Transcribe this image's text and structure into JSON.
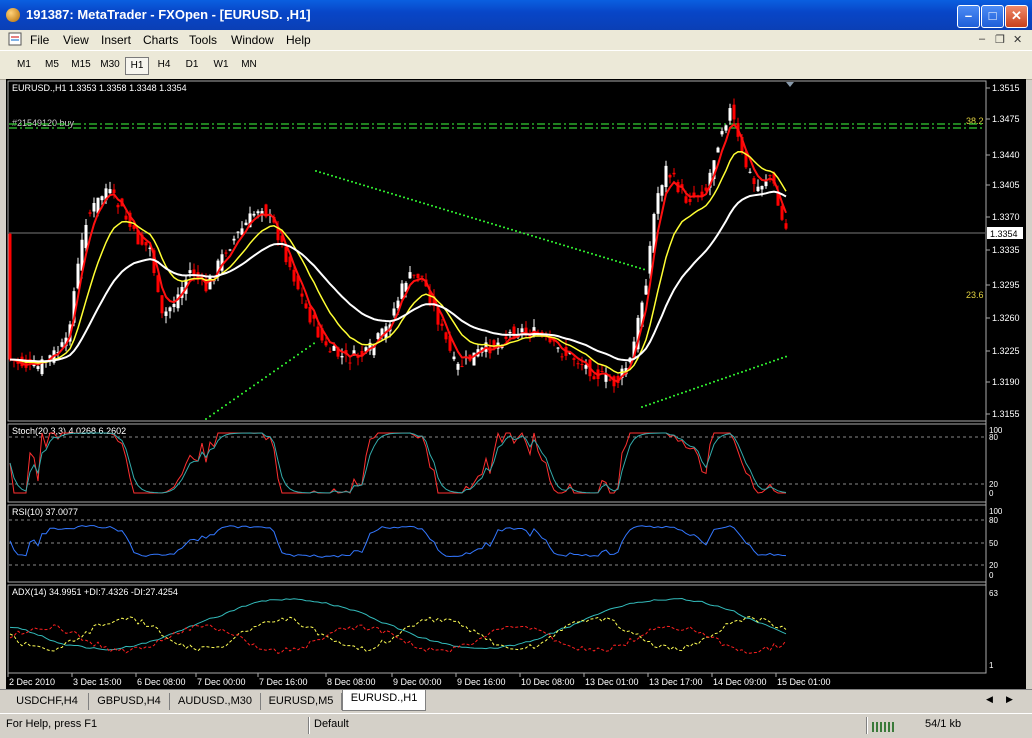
{
  "window": {
    "title": "191387: MetaTrader - FXOpen - [EURUSD. ,H1]"
  },
  "menu": [
    "File",
    "View",
    "Insert",
    "Charts",
    "Tools",
    "Window",
    "Help"
  ],
  "timeframes": [
    "M1",
    "M5",
    "M15",
    "M30",
    "H1",
    "H4",
    "D1",
    "W1",
    "MN"
  ],
  "active_timeframe": "H1",
  "chart": {
    "header": "EURUSD.,H1  1.3353 1.3358 1.3348 1.3354",
    "order_label": "#21549120 buy",
    "fib_top": "38.2",
    "fib_bottom": "23.6",
    "current_price": "1.3354",
    "price_ticks": [
      "1.3515",
      "1.3475",
      "1.3440",
      "1.3405",
      "1.3370",
      "1.3335",
      "1.3295",
      "1.3260",
      "1.3225",
      "1.3190",
      "1.3155"
    ],
    "time_ticks": [
      "2 Dec 2010",
      "3 Dec 15:00",
      "6 Dec 08:00",
      "7 Dec 00:00",
      "7 Dec 16:00",
      "8 Dec 08:00",
      "9 Dec 00:00",
      "9 Dec 16:00",
      "10 Dec 08:00",
      "13 Dec 01:00",
      "13 Dec 17:00",
      "14 Dec 09:00",
      "15 Dec 01:00"
    ],
    "stoch": {
      "label": "Stoch(20,3,3) 4.0268 6.2602",
      "levels": [
        "100",
        "80",
        "20",
        "0"
      ]
    },
    "rsi": {
      "label": "RSI(10) 37.0077",
      "levels": [
        "100",
        "80",
        "50",
        "20",
        "0"
      ]
    },
    "adx": {
      "label": "ADX(14) 34.9951 +DI:7.4326 -DI:27.4254",
      "levels": [
        "63",
        "1"
      ]
    },
    "colors": {
      "up": "#ffffff",
      "down": "#ff0000",
      "ma_fast": "#ff1010",
      "ma_mid": "#ffff33",
      "ma_slow": "#ffffff",
      "psar": "#33ff33",
      "fib": "#33cc33",
      "stoch_main": "#ff3030",
      "stoch_signal": "#33aaaa",
      "rsi": "#3377ff",
      "adx": "#33bbbb",
      "plus_di": "#ffff55",
      "minus_di": "#ff2020"
    }
  },
  "tabs": [
    "USDCHF,H4",
    "GBPUSD,H4",
    "AUDUSD.,M30",
    "EURUSD,M5",
    "EURUSD.,H1"
  ],
  "active_tab": "EURUSD.,H1",
  "status": {
    "help": "For Help, press F1",
    "profile": "Default",
    "traffic": "54/1 kb"
  }
}
